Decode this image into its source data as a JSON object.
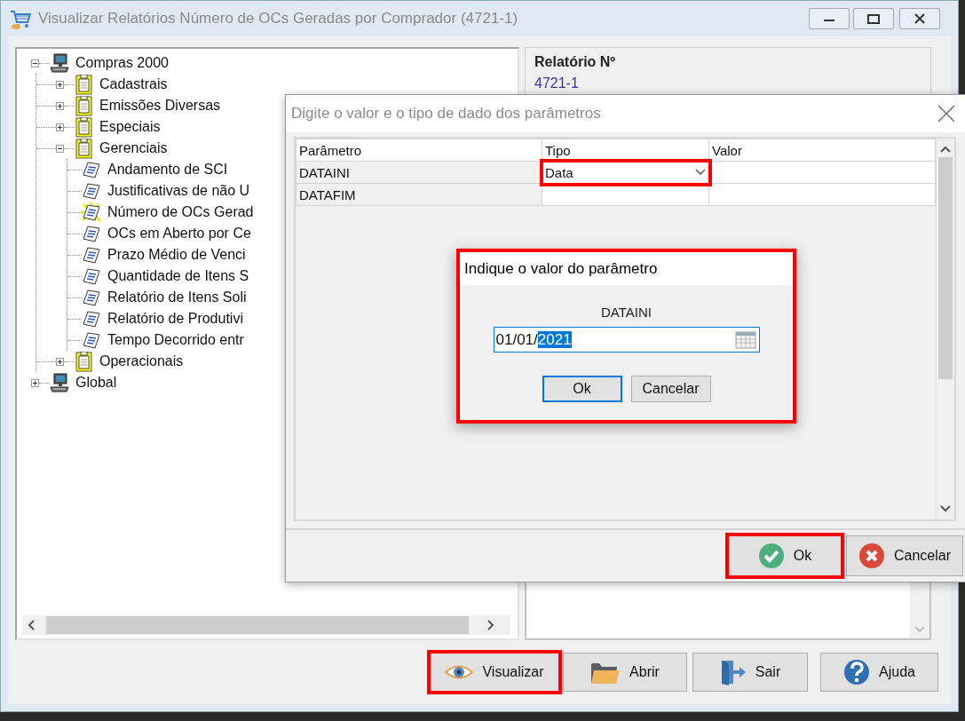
{
  "window": {
    "title": "Visualizar Relatórios Número de OCs Geradas por Comprador (4721-1)"
  },
  "tree": [
    {
      "label": "Compras 2000",
      "kind": "computer",
      "expanded": true,
      "children": [
        {
          "label": "Cadastrais",
          "kind": "folder",
          "expanded": false
        },
        {
          "label": "Emissões Diversas",
          "kind": "folder",
          "expanded": false
        },
        {
          "label": "Especiais",
          "kind": "folder",
          "expanded": false
        },
        {
          "label": "Gerenciais",
          "kind": "folder",
          "expanded": true,
          "children": [
            {
              "label": "Andamento de SCI",
              "kind": "report",
              "selected": false
            },
            {
              "label": "Justificativas de não U",
              "kind": "report",
              "selected": false
            },
            {
              "label": "Número de OCs Gerad",
              "kind": "report",
              "selected": true
            },
            {
              "label": "OCs em Aberto por Ce",
              "kind": "report",
              "selected": false
            },
            {
              "label": "Prazo Médio de Venci",
              "kind": "report",
              "selected": false
            },
            {
              "label": "Quantidade de Itens S",
              "kind": "report",
              "selected": false
            },
            {
              "label": "Relatório de Itens Soli",
              "kind": "report",
              "selected": false
            },
            {
              "label": "Relatório de Produtivi",
              "kind": "report",
              "selected": false
            },
            {
              "label": "Tempo Decorrido entr",
              "kind": "report",
              "selected": false
            }
          ]
        },
        {
          "label": "Operacionais",
          "kind": "folder",
          "expanded": false
        }
      ]
    },
    {
      "label": "Global",
      "kind": "computer",
      "expanded": false
    }
  ],
  "report_info": {
    "label": "Relatório Nº",
    "number": "4721-1"
  },
  "buttons": [
    {
      "label": "Visualizar",
      "kind": "view",
      "highlighted": true
    },
    {
      "label": "Abrir",
      "kind": "open",
      "highlighted": false
    },
    {
      "label": "Sair",
      "kind": "exit",
      "highlighted": false
    },
    {
      "label": "Ajuda",
      "kind": "help",
      "highlighted": false
    }
  ],
  "param_dialog": {
    "title": "Digite o valor e o tipo de dado dos parâmetros",
    "columns": [
      "Parâmetro",
      "Tipo",
      "Valor"
    ],
    "rows": [
      {
        "name": "DATAINI",
        "type": "Data",
        "type_highlighted": true
      },
      {
        "name": "DATAFIM",
        "type_highlighted": false
      }
    ],
    "buttons": [
      {
        "label": "Ok",
        "kind": "ok",
        "highlighted": true
      },
      {
        "label": "Cancelar",
        "kind": "cancel",
        "highlighted": false
      }
    ]
  },
  "value_dialog": {
    "title": "Indique o valor do parâmetro",
    "highlighted": true,
    "parameter": "DATAINI",
    "value": "01/01/",
    "selection": "2021",
    "buttons": [
      {
        "label": "Ok",
        "default": true
      },
      {
        "label": "Cancelar",
        "default": false
      }
    ]
  }
}
